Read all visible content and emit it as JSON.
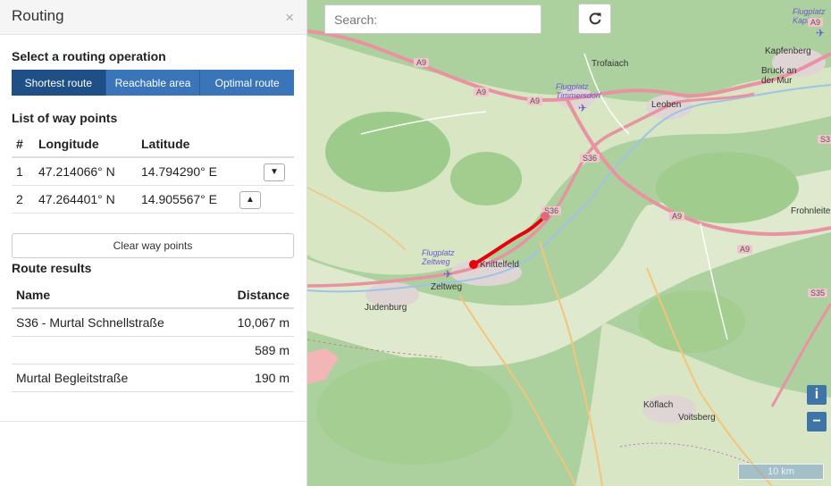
{
  "sidebar": {
    "title": "Routing",
    "close_label": "×",
    "routing_section_title": "Select a routing operation",
    "operations": [
      "Shortest route",
      "Reachable area",
      "Optimal route"
    ],
    "active_operation": "Shortest route",
    "waypoints_title": "List of way points",
    "waypoints_headers": {
      "num": "#",
      "lon": "Longitude",
      "lat": "Latitude"
    },
    "waypoints": [
      {
        "num": "1",
        "lon": "47.214066° N",
        "lat": "14.794290° E",
        "button": "▼"
      },
      {
        "num": "2",
        "lon": "47.264401° N",
        "lat": "14.905567° E",
        "button": "▲"
      }
    ],
    "clear_button": "Clear way points",
    "results_title": "Route results",
    "results_headers": {
      "name": "Name",
      "distance": "Distance"
    },
    "results": [
      {
        "name": "S36 - Murtal Schnellstraße",
        "distance": "10,067 m"
      },
      {
        "name": "",
        "distance": "589 m"
      },
      {
        "name": "Murtal Begleitstraße",
        "distance": "190 m"
      }
    ]
  },
  "map": {
    "search_placeholder": "Search:",
    "refresh_icon": "refresh-icon",
    "zoom_in_label": "i",
    "zoom_out_label": "−",
    "scale_label": "10 km",
    "route_color": "#e8000b",
    "labels": {
      "trofaiach": "Trofaiach",
      "leoben": "Leoben",
      "kapfenberg": "Kapfenberg",
      "bruck": "Bruck an\nder Mur",
      "flugplatz_top": "Flugplatz\nKapfenb",
      "flugplatz_timm": "Flugplatz\nTimmersdorf",
      "knittelfeld": "Knittelfeld",
      "zeltweg": "Zeltweg",
      "flugplatz_zelt": "Flugplatz\nZeltweg",
      "judenburg": "Judenburg",
      "frohnleite": "Frohnleite",
      "koflach": "Köflach",
      "voitsberg": "Voitsberg"
    },
    "road_shields": [
      "A9",
      "A9",
      "A9",
      "A9",
      "A9",
      "A9",
      "S36",
      "S36",
      "S3",
      "S35"
    ]
  }
}
